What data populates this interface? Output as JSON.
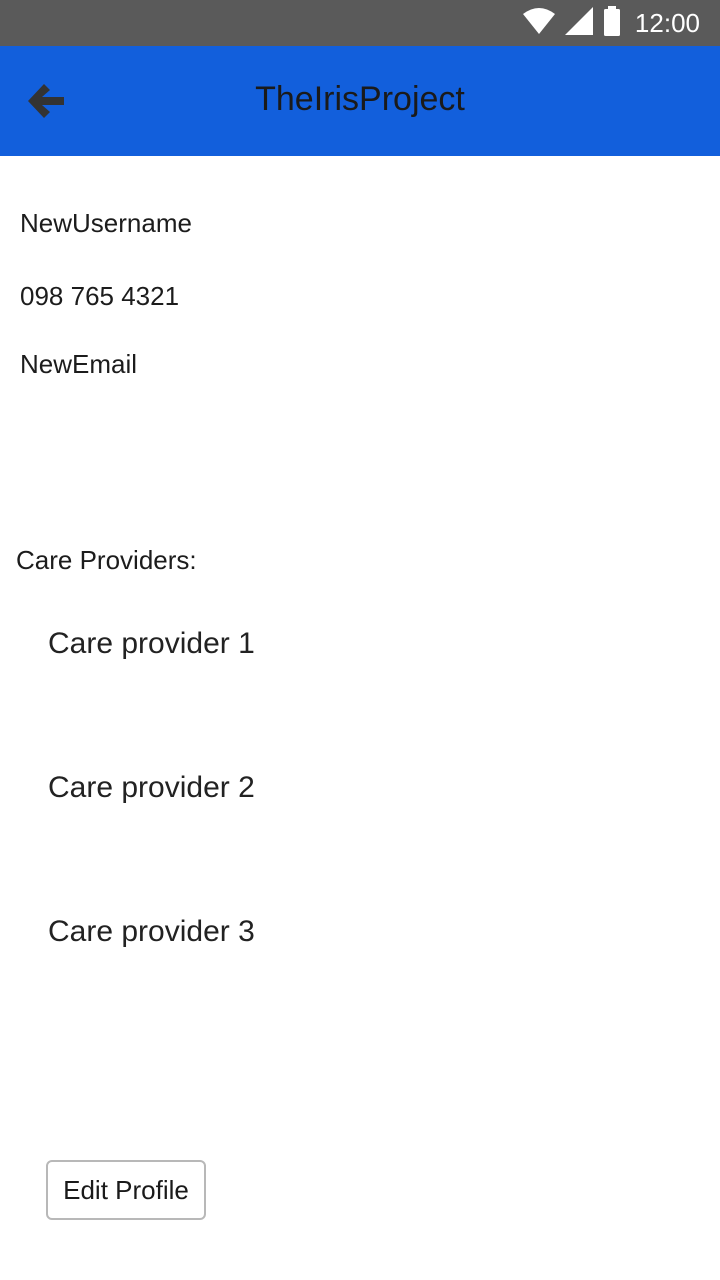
{
  "status_bar": {
    "time": "12:00",
    "icons": [
      "wifi-icon",
      "signal-icon",
      "battery-icon"
    ]
  },
  "app_bar": {
    "title": "TheIrisProject",
    "back_icon": "arrow-left-icon",
    "background_color": "#125fdc"
  },
  "profile": {
    "username": "NewUsername",
    "phone": "098 765 4321",
    "email": "NewEmail"
  },
  "care_providers": {
    "label": "Care Providers:",
    "items": [
      "Care provider 1",
      "Care provider 2",
      "Care provider 3"
    ]
  },
  "edit_button": {
    "label": "Edit Profile"
  }
}
